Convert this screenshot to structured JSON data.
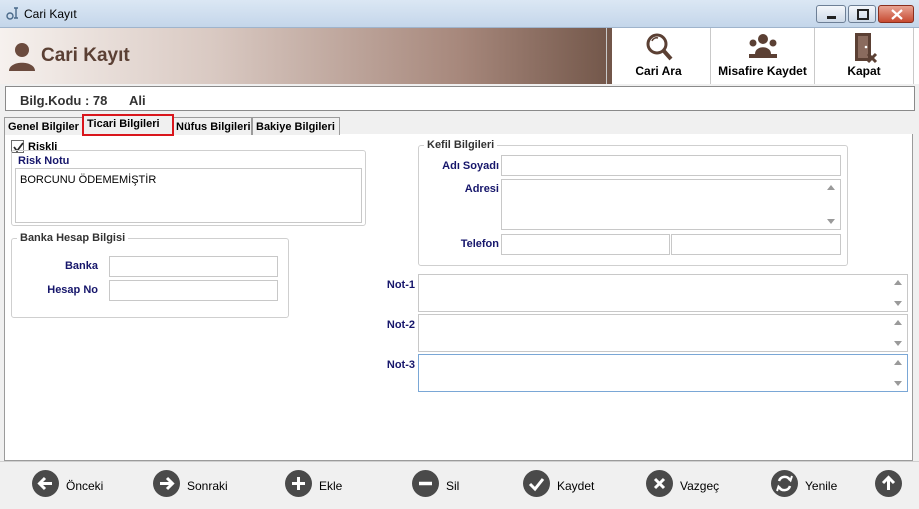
{
  "window": {
    "title": "Cari Kayıt"
  },
  "header": {
    "title": "Cari Kayıt",
    "buttons": {
      "cari_ara": "Cari Ara",
      "misafire_kaydet": "Misafire Kaydet",
      "kapat": "Kapat"
    }
  },
  "info": {
    "code": "Bilg.Kodu : 78",
    "name": "Ali"
  },
  "tabs": [
    {
      "label": "Genel Bilgiler",
      "active": false
    },
    {
      "label": "Ticari Bilgileri",
      "active": true
    },
    {
      "label": "Nüfus Bilgileri",
      "active": false
    },
    {
      "label": "Bakiye Bilgileri",
      "active": false
    }
  ],
  "form": {
    "riskli": {
      "label": "Riskli",
      "checked": true
    },
    "risk_notu": {
      "label": "Risk Notu",
      "value": "BORCUNU ÖDEMEMİŞTİR"
    },
    "banka_hesap": {
      "title": "Banka Hesap Bilgisi",
      "banka_label": "Banka",
      "banka_value": "",
      "hesap_label": "Hesap No",
      "hesap_value": ""
    },
    "kefil": {
      "title": "Kefil Bilgileri",
      "adi_soyadi_label": "Adı Soyadı",
      "adi_soyadi_value": "",
      "adresi_label": "Adresi",
      "adresi_value": "",
      "telefon_label": "Telefon",
      "telefon1_value": "",
      "telefon2_value": ""
    },
    "notes": [
      {
        "label": "Not-1",
        "value": ""
      },
      {
        "label": "Not-2",
        "value": ""
      },
      {
        "label": "Not-3",
        "value": ""
      }
    ]
  },
  "toolbar": {
    "onceki": "Önceki",
    "sonraki": "Sonraki",
    "ekle": "Ekle",
    "sil": "Sil",
    "kaydet": "Kaydet",
    "vazgec": "Vazgeç",
    "yenile": "Yenile"
  },
  "icons": {
    "window": "app-icon",
    "header": "user-icon",
    "cari_ara": "search-icon",
    "misafire_kaydet": "users-icon",
    "kapat": "exit-door-icon",
    "onceki": "arrow-left-icon",
    "sonraki": "arrow-right-icon",
    "ekle": "plus-icon",
    "sil": "minus-icon",
    "kaydet": "check-icon",
    "vazgec": "x-icon",
    "yenile": "refresh-icon",
    "scroll_top": "arrow-up-icon"
  },
  "colors": {
    "title_text": "#5b4034",
    "label_blue": "#16166b",
    "active_tab_border": "#d9161c",
    "button_dark": "#4a4a4a"
  }
}
